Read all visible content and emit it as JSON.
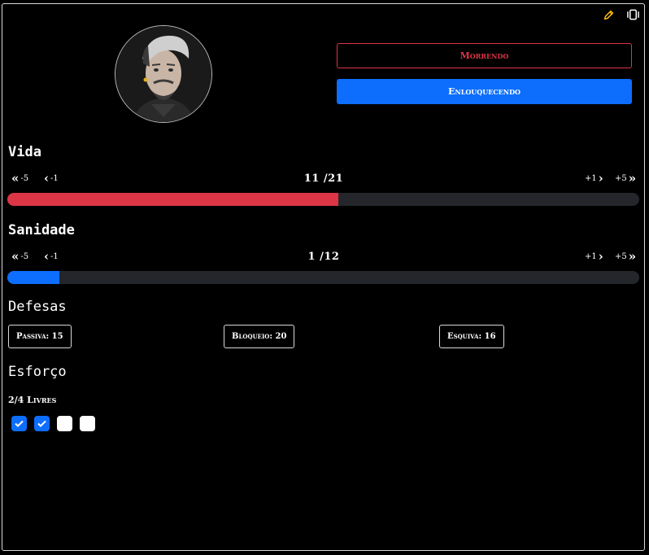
{
  "header": {
    "edit_icon": "pencil-icon",
    "layout_icon": "panels-icon"
  },
  "status_buttons": {
    "dying": "Morrendo",
    "maddening": "Enlouquecendo"
  },
  "vida": {
    "title": "Vida",
    "minus5": "-5",
    "minus1": "-1",
    "plus1": "+1",
    "plus5": "+5",
    "display": "11 /21",
    "current": 11,
    "max": 21,
    "fill_fraction": 0.524,
    "color": "#dc3545"
  },
  "sanidade": {
    "title": "Sanidade",
    "minus5": "-5",
    "minus1": "-1",
    "plus1": "+1",
    "plus5": "+5",
    "display": "1 /12",
    "current": 1,
    "max": 12,
    "fill_fraction": 0.083,
    "color": "#0d6efd"
  },
  "defesas": {
    "title": "Defesas",
    "passiva": "Passiva: 15",
    "bloqueio": "Bloqueio: 20",
    "esquiva": "Esquiva: 16"
  },
  "esforco": {
    "title": "Esforço",
    "free_label": "2/4 Livres",
    "checks": [
      true,
      true,
      false,
      false
    ]
  },
  "colors": {
    "accent": "#0d6efd",
    "danger": "#dc3545",
    "edit_icon": "#ffc107",
    "bar_track": "#24262b"
  }
}
